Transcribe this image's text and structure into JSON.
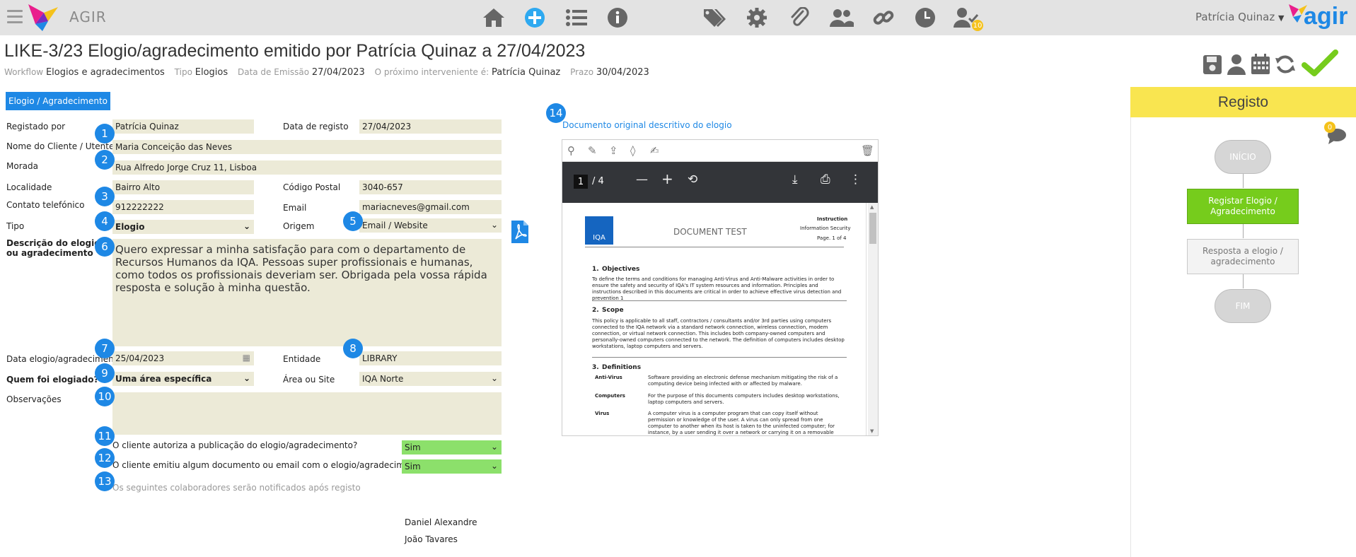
{
  "topbar": {
    "app_name": "AGIR",
    "user_name": "Patrícia Quinaz",
    "notification_count": "10",
    "brand": "agir"
  },
  "header": {
    "title": "LIKE-3/23 Elogio/agradecimento emitido por Patrícia Quinaz a 27/04/2023",
    "meta": {
      "workflow_label": "Workflow",
      "workflow_value": "Elogios e agradecimentos",
      "tipo_label": "Tipo",
      "tipo_value": "Elogios",
      "emissao_label": "Data de Emissão",
      "emissao_value": "27/04/2023",
      "interveniente_label": "O próximo interveniente é:",
      "interveniente_value": "Patrícia Quinaz",
      "prazo_label": "Prazo",
      "prazo_value": "30/04/2023"
    }
  },
  "tab": {
    "label": "Elogio / Agradecimento"
  },
  "form": {
    "registado_por_label": "Registado por",
    "registado_por_value": "Patrícia Quinaz",
    "data_registo_label": "Data de registo",
    "data_registo_value": "27/04/2023",
    "nome_cliente_label": "Nome do Cliente / Utente",
    "nome_cliente_value": "Maria Conceição das Neves",
    "morada_label": "Morada",
    "morada_value": "Rua Alfredo Jorge Cruz 11, Lisboa",
    "localidade_label": "Localidade",
    "localidade_value": "Bairro Alto",
    "codigo_postal_label": "Código Postal",
    "codigo_postal_value": "3040-657",
    "contato_label": "Contato telefónico",
    "contato_value": "912222222",
    "email_label": "Email",
    "email_value": "mariacneves@gmail.com",
    "tipo_label": "Tipo",
    "tipo_value": "Elogio",
    "origem_label": "Origem",
    "origem_value": "Email / Website",
    "descricao_label_1": "Descrição do elogio",
    "descricao_label_2": "ou agradecimento",
    "descricao_value": "Quero expressar a minha satisfação para com o departamento de Recursos Humanos da IQA. Pessoas super profissionais e humanas, como todos os profissionais deveriam ser. Obrigada pela vossa rápida resposta e solução à minha questão.",
    "data_elogio_label": "Data elogio/agradecimento",
    "data_elogio_value": "25/04/2023",
    "entidade_label": "Entidade",
    "entidade_value": "LIBRARY",
    "quem_label": "Quem foi elogiado?",
    "quem_value": "Uma área específica",
    "area_label": "Área ou Site",
    "area_value": "IQA Norte",
    "observacoes_label": "Observações",
    "observacoes_value": "",
    "autoriza_label": "O cliente autoriza a publicação do elogio/agradecimento?",
    "autoriza_value": "Sim",
    "emitiu_label": "O cliente emitiu algum documento ou email com o elogio/agradecimento?",
    "emitiu_value": "Sim",
    "notificados_label": "Os seguintes colaboradores serão notificados após registo",
    "colaboradores": [
      "Daniel Alexandre",
      "João Tavares"
    ]
  },
  "markers": [
    "1",
    "2",
    "3",
    "4",
    "5",
    "6",
    "7",
    "8",
    "9",
    "10",
    "11",
    "12",
    "13",
    "14"
  ],
  "document": {
    "link": "Documento original descritivo do elogio",
    "page_current": "1",
    "page_total": "/ 4",
    "logo": "IQA",
    "doc_title": "DOCUMENT TEST",
    "doc_r1": "Instruction",
    "doc_r2": "Information Security",
    "doc_r3": "Page. 1 of 4",
    "s1_num": "1.",
    "s1_title": "Objectives",
    "s1_text": "To define the terms and conditions for managing Anti-Virus and Anti-Malware activities in order to ensure the safety and security of IQA's IT system resources and information. Principles and instructions described in this documents are critical in order to achieve effective virus detection and prevention 1",
    "s2_num": "2.",
    "s2_title": "Scope",
    "s2_text": "This policy is applicable to all staff, contractors / consultants and/or 3rd parties using computers connected to the IQA network via a standard network connection, wireless connection, modem connection, or virtual network connection. This includes both company-owned computers and personally-owned computers connected to the network. The definition of computers includes desktop workstations, laptop computers and servers.",
    "s3_num": "3.",
    "s3_title": "Definitions",
    "d1_term": "Anti-Virus",
    "d1_text": "Software providing an electronic defense mechanism mitigating the risk of a computing device being infected with or affected by malware.",
    "d2_term": "Computers",
    "d2_text": "For the purpose of this documents computers includes desktop workstations, laptop computers and servers.",
    "d3_term": "Virus",
    "d3_text": "A computer virus is a computer program that can copy itself without permission or knowledge of the user. A virus can only spread from one computer to another when its host is taken to the uninfected computer; for instance, by a user sending it over a network or carrying it on a removable media."
  },
  "workflow_panel": {
    "title": "Registo",
    "comment_count": "0",
    "nodes": {
      "start": "INÍCIO",
      "step1": "Registar Elogio / Agradecimento",
      "step2": "Resposta a elogio / agradecimento",
      "end": "FIM"
    }
  },
  "colors": {
    "accent": "#1e88e5",
    "field_bg": "#ecead7",
    "green_field": "#8ce06b",
    "active_step": "#76cc1c",
    "panel_header": "#f9e550",
    "badge": "#f5c21b"
  }
}
